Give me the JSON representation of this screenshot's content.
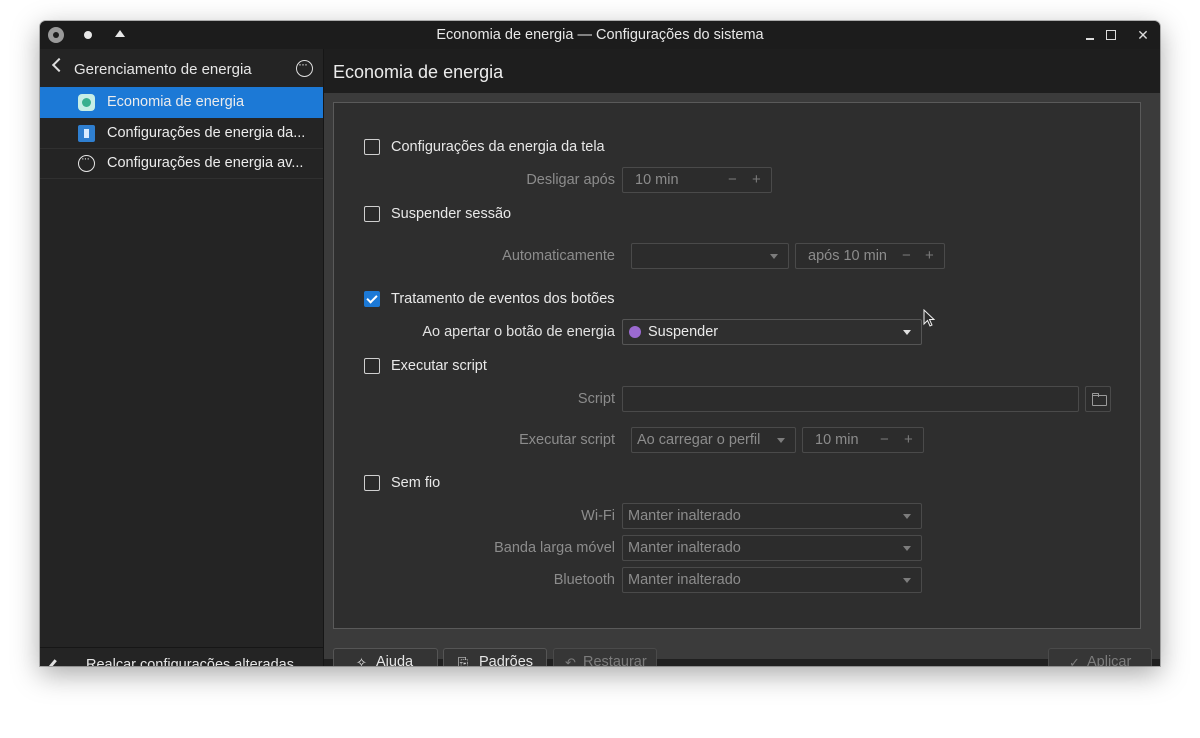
{
  "window": {
    "title": "Economia de energia — Configurações do sistema"
  },
  "sidebar": {
    "title": "Gerenciamento de energia",
    "items": [
      {
        "label": "Economia de energia",
        "icon": "power-save-icon"
      },
      {
        "label": "Configurações de energia da...",
        "icon": "energy-info-icon"
      },
      {
        "label": "Configurações de energia av...",
        "icon": "advanced-icon"
      }
    ],
    "footer_label": "Realçar configurações alteradas"
  },
  "main": {
    "title": "Economia de energia",
    "screen_energy": {
      "label": "Configurações da energia da tela",
      "checked": false,
      "off_after_label": "Desligar após",
      "off_after_value": "10 min"
    },
    "suspend_session": {
      "label": "Suspender sessão",
      "checked": false,
      "auto_label": "Automaticamente",
      "auto_value": "",
      "after_value": "após 10 min"
    },
    "button_events": {
      "label": "Tratamento de eventos dos botões",
      "checked": true,
      "power_button_label": "Ao apertar o botão de energia",
      "power_button_value": "Suspender"
    },
    "run_script": {
      "label": "Executar script",
      "checked": false,
      "script_label": "Script",
      "script_value": "",
      "when_label": "Executar script",
      "when_value": "Ao carregar o perfil",
      "delay_value": "10 min"
    },
    "wireless": {
      "label": "Sem fio",
      "checked": false,
      "wifi_label": "Wi-Fi",
      "wifi_value": "Manter inalterado",
      "mobile_label": "Banda larga móvel",
      "mobile_value": "Manter inalterado",
      "bluetooth_label": "Bluetooth",
      "bluetooth_value": "Manter inalterado"
    }
  },
  "buttons": {
    "help": "Ajuda",
    "defaults": "Padrões",
    "reset": "Restaurar",
    "apply": "Aplicar"
  },
  "colors": {
    "accent": "#1c79d6",
    "window_bg": "#202020",
    "panel_bg": "#2e2e2e"
  }
}
